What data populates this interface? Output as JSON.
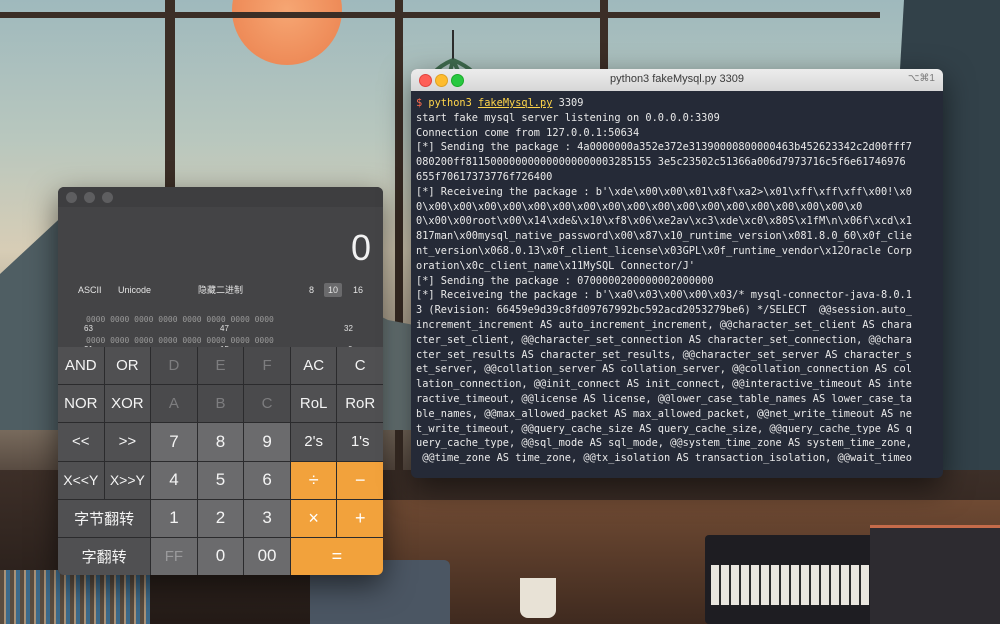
{
  "calculator": {
    "display_value": "0",
    "modes": {
      "ascii": "ASCII",
      "unicode": "Unicode",
      "binary_toggle": "隐藏二进制",
      "base8": "8",
      "base10": "10",
      "base16": "16"
    },
    "bit_rows": [
      {
        "bits": "0000 0000 0000 0000 0000 0000 0000 0000",
        "labels": [
          "63",
          "47",
          "32"
        ]
      },
      {
        "bits": "0000 0000 0000 0000 0000 0000 0000 0000",
        "labels": [
          "31",
          "15",
          "0"
        ]
      }
    ],
    "keys": [
      [
        "AND",
        "OR",
        "D",
        "E",
        "F",
        "AC",
        "C"
      ],
      [
        "NOR",
        "XOR",
        "A",
        "B",
        "C",
        "RoL",
        "RoR"
      ],
      [
        "<<",
        ">>",
        "7",
        "8",
        "9",
        "2's",
        "1's"
      ],
      [
        "X<<Y",
        "X>>Y",
        "4",
        "5",
        "6",
        "÷",
        "−"
      ],
      [
        "字节翻转",
        "1",
        "2",
        "3",
        "×",
        "+"
      ],
      [
        "字翻转",
        "FF",
        "0",
        "00",
        "="
      ]
    ]
  },
  "terminal": {
    "title": "python3 fakeMysql.py 3309",
    "shortcut": "⌥⌘1",
    "prompt_symbol": "$",
    "command": "python3",
    "script": "fakeMysql.py",
    "port_arg": "3309",
    "lines": [
      "start fake mysql server listening on 0.0.0.0:3309",
      "Connection come from 127.0.0.1:50634",
      "[*] Sending the package : 4a0000000a352e372e31390000800000463b452623342c2d00fff7",
      "080200ff811500000000000000000003285155 3e5c23502c51366a006d7973716c5f6e61746976",
      "655f70617373776f726400",
      "[*] Receiveing the package : b'\\xde\\x00\\x00\\x01\\x8f\\xa2>\\x01\\xff\\xff\\xff\\x00!\\x0",
      "0\\x00\\x00\\x00\\x00\\x00\\x00\\x00\\x00\\x00\\x00\\x00\\x00\\x00\\x00\\x00\\x00\\x00\\x0",
      "0\\x00\\x00root\\x00\\x14\\xde&\\x10\\xf8\\x06\\xe2av\\xc3\\xde\\xc0\\x80S\\x1fM\\n\\x06f\\xcd\\x1",
      "817man\\x00mysql_native_password\\x00\\x87\\x10_runtime_version\\x081.8.0_60\\x0f_clie",
      "nt_version\\x068.0.13\\x0f_client_license\\x03GPL\\x0f_runtime_vendor\\x12Oracle Corp",
      "oration\\x0c_client_name\\x11MySQL Connector/J'",
      "[*] Sending the package : 0700000200000002000000",
      "[*] Receiveing the package : b'\\xa0\\x03\\x00\\x00\\x03/* mysql-connector-java-8.0.1",
      "3 (Revision: 66459e9d39c8fd09767992bc592acd2053279be6) */SELECT  @@session.auto_",
      "increment_increment AS auto_increment_increment, @@character_set_client AS chara",
      "cter_set_client, @@character_set_connection AS character_set_connection, @@chara",
      "cter_set_results AS character_set_results, @@character_set_server AS character_s",
      "et_server, @@collation_server AS collation_server, @@collation_connection AS col",
      "lation_connection, @@init_connect AS init_connect, @@interactive_timeout AS inte",
      "ractive_timeout, @@license AS license, @@lower_case_table_names AS lower_case_ta",
      "ble_names, @@max_allowed_packet AS max_allowed_packet, @@net_write_timeout AS ne",
      "t_write_timeout, @@query_cache_size AS query_cache_size, @@query_cache_type AS q",
      "uery_cache_type, @@sql_mode AS sql_mode, @@system_time_zone AS system_time_zone,",
      " @@time_zone AS time_zone, @@tx_isolation AS transaction_isolation, @@wait_timeo"
    ]
  }
}
